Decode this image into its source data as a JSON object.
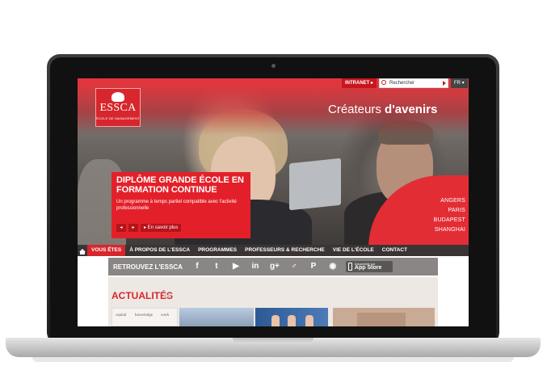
{
  "site": {
    "logo": {
      "name": "ESSCA",
      "subtitle": "ÉCOLE DE MANAGEMENT"
    },
    "topbar": {
      "intranet": "INTRANET ▸",
      "search_label": "Rechercher",
      "lang": "FR ▾"
    },
    "tagline": {
      "part1": "Créateurs",
      "part2": " d'avenirs"
    },
    "promo": {
      "title": "DIPLÔME GRANDE ÉCOLE EN FORMATION CONTINUE",
      "subtitle": "Un programme à temps partiel compatible avec l'activité professionnelle",
      "prev": "◂",
      "next": "▸",
      "more": "▸ En savoir plus"
    },
    "cities": [
      "ANGERS",
      "PARIS",
      "BUDAPEST",
      "SHANGHAI"
    ],
    "nav": {
      "items": [
        "VOUS ÊTES",
        "À PROPOS DE L'ESSCA",
        "PROGRAMMES",
        "PROFESSEURS & RECHERCHE",
        "VIE DE L'ÉCOLE",
        "CONTACT"
      ]
    },
    "social": {
      "label": "RETROUVEZ L'ESSCA",
      "icons": [
        "f",
        "t",
        "▶",
        "in",
        "g+",
        "♂",
        "P",
        "◉"
      ],
      "appstore_small": "Disponible sur",
      "appstore_big": "App Store"
    },
    "news": {
      "title": "ACTUALITÉS",
      "thumb1_words": [
        "capital",
        "knowledge",
        "work"
      ]
    }
  }
}
